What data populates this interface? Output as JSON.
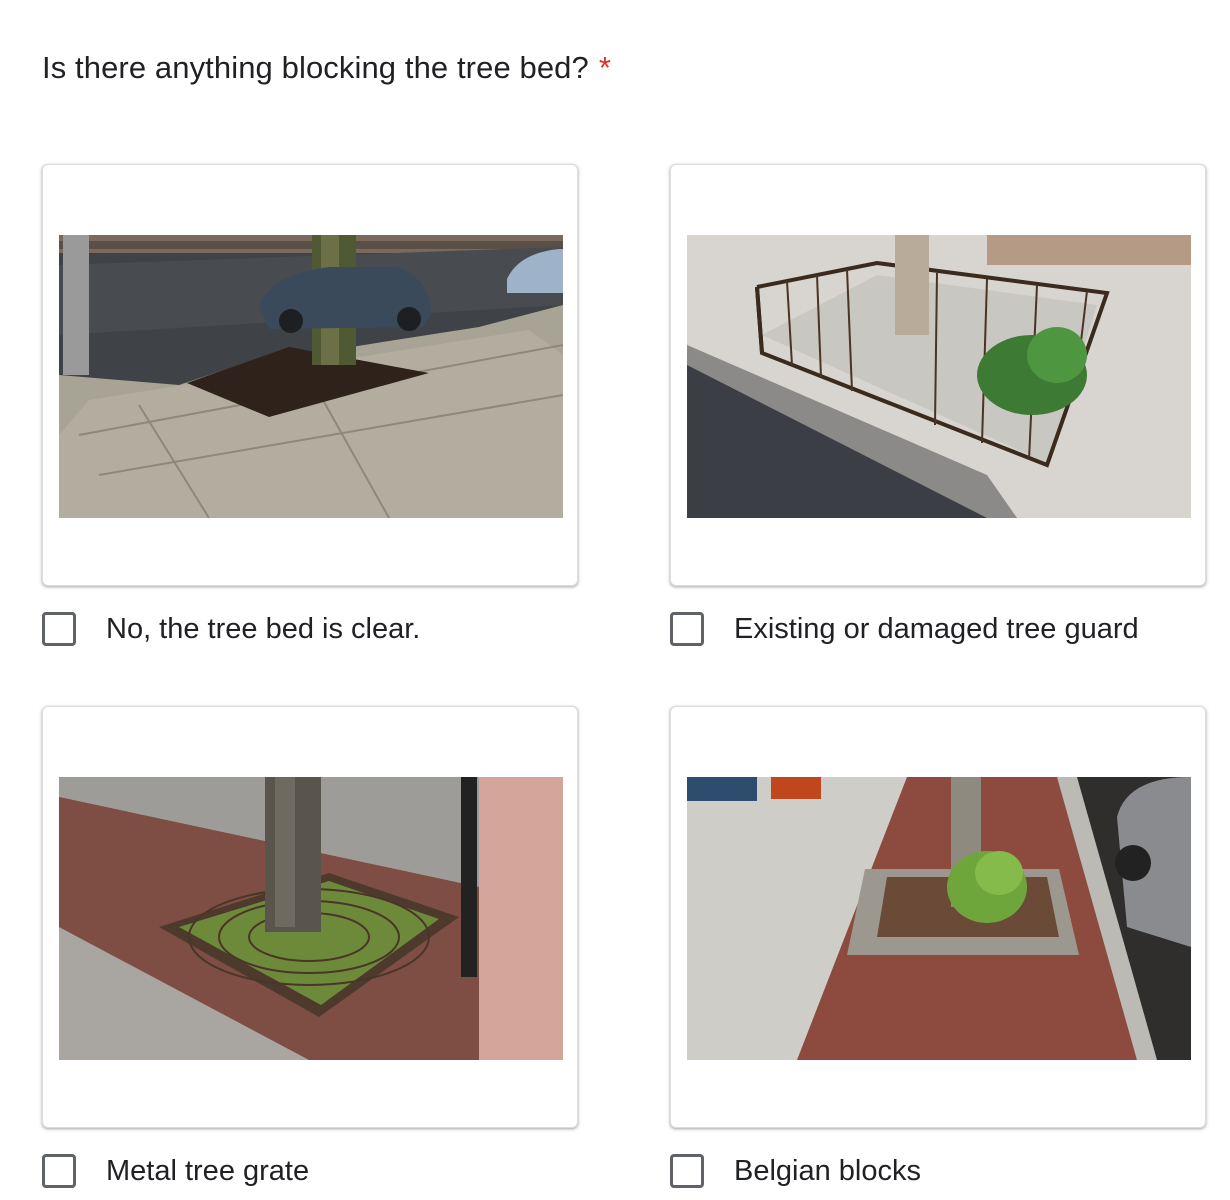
{
  "question": {
    "text": "Is there anything blocking the tree bed?",
    "required_marker": "*",
    "required_color": "#d93025"
  },
  "options": [
    {
      "label": "No, the tree bed is clear.",
      "checked": false,
      "image": "tree bed with mulch on sidewalk"
    },
    {
      "label": "Existing or damaged tree guard",
      "checked": false,
      "image": "tree bed with iron fence guard"
    },
    {
      "label": "Metal tree grate",
      "checked": false,
      "image": "tree with round metal grate in brick sidewalk"
    },
    {
      "label": "Belgian blocks",
      "checked": false,
      "image": "tree bed edged with cobblestones"
    }
  ]
}
